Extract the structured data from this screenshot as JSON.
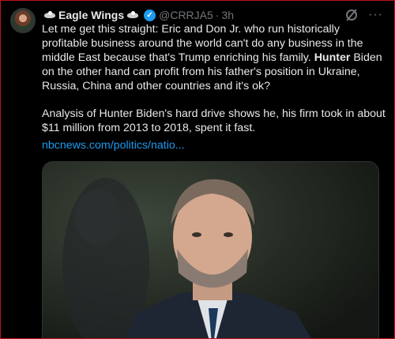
{
  "author": {
    "name": "Eagle Wings",
    "handle": "@CRRJA5",
    "separator": "·",
    "time": "3h"
  },
  "icons": {
    "avatar": "avatar",
    "name_left": "eagle-emoji-icon",
    "name_right": "eagle-emoji-icon",
    "verified": "verified-badge-icon",
    "grok": "grok-icon",
    "more": "more-options-icon"
  },
  "post": {
    "paragraph1_a": "Let me get this straight: Eric and Don Jr. who run historically profitable business around the world can't do any business in the middle East because that's Trump enriching his family. ",
    "paragraph1_bold": "Hunter",
    "paragraph1_b": " Biden on the other hand can profit from his father's position in Ukraine, Russia, China and other countries and it's ok?",
    "paragraph2": "Analysis of Hunter Biden's hard drive shows he, his firm took in about $11 million from 2013 to 2018, spent it fast.",
    "link": "nbcnews.com/politics/natio..."
  },
  "media": {
    "description": "photo of a man in a suit and tie"
  },
  "colors": {
    "background": "#000000",
    "text": "#e7e9ea",
    "muted": "#71767b",
    "link": "#1d9bf0",
    "verified": "#1d9bf0"
  }
}
